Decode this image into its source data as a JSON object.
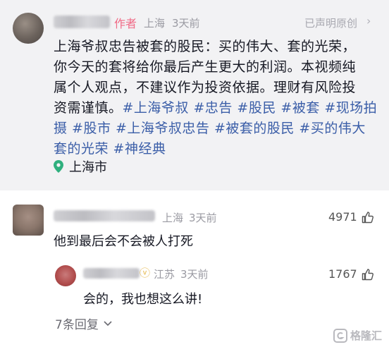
{
  "post": {
    "author_tag": "作者",
    "location": "上海",
    "time": "3天前",
    "declared": "已声明原创",
    "text_lines": [
      "上海爷叔忠告被套的股民：买的伟大、套的光荣，",
      "你今天的套将给你最后产生更大的利润。本视频纯",
      "属个人观点，不建议作为投资依据。理财有风险投"
    ],
    "line4_plain": "资需谨慎。",
    "line4_tags": "#上海爷叔 #忠告 #股民 #被套 #现场拍",
    "line5_tags": "摄 #股市 #上海爷叔忠告 #被套的股民 #买的伟大",
    "line6_tags": "套的光荣 #神经典",
    "location_tag": "上海市"
  },
  "comment1": {
    "location": "上海",
    "time": "3天前",
    "text": "他到最后会不会被人打死",
    "likes": "4971"
  },
  "reply1": {
    "location": "江苏",
    "time": "3天前",
    "text": "会的，我也想这么讲!",
    "likes": "1767"
  },
  "more_replies": "7条回复",
  "watermark": "格隆汇",
  "colors": {
    "hashtag": "#3b5ea8",
    "author_tag": "#f06a86",
    "post_bg": "#f2f2f4"
  }
}
